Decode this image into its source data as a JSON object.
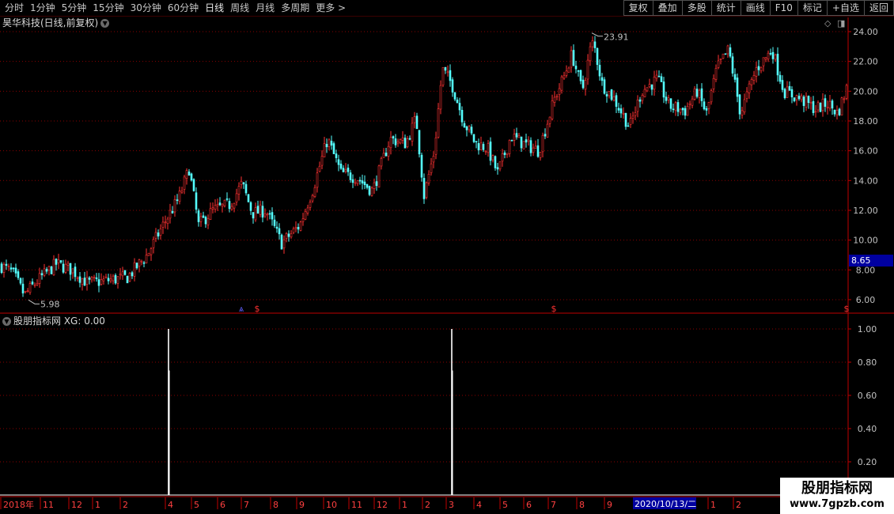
{
  "toolbar": {
    "periods": [
      "分时",
      "1分钟",
      "5分钟",
      "15分钟",
      "30分钟",
      "60分钟",
      "日线",
      "周线",
      "月线",
      "多周期",
      "更多 >"
    ],
    "active": "日线",
    "buttons": [
      "复权",
      "叠加",
      "多股",
      "统计",
      "画线",
      "F10",
      "标记",
      "+自选",
      "返回"
    ]
  },
  "stock": {
    "title": "昊华科技(日线,前复权)"
  },
  "main_chart": {
    "y_ticks": [
      "24.00",
      "22.00",
      "20.00",
      "18.00",
      "16.00",
      "14.00",
      "12.00",
      "10.00",
      "8.00",
      "6.00"
    ],
    "current_price": "8.65",
    "high_label": "23.91",
    "low_label": "5.98"
  },
  "indicator": {
    "title": "股朋指标网 XG: 0.00",
    "y_ticks": [
      "1.00",
      "0.80",
      "0.60",
      "0.40",
      "0.20"
    ]
  },
  "x_axis": {
    "labels": [
      "2018年",
      "11",
      "12",
      "1",
      "2",
      "4",
      "5",
      "6",
      "7",
      "8",
      "9",
      "10",
      "11",
      "12",
      "1",
      "2",
      "3",
      "4",
      "5",
      "6",
      "7",
      "8",
      "9",
      "1",
      "2"
    ],
    "highlight": "2020/10/13/二"
  },
  "watermark": {
    "line1": "股朋指标网",
    "line2": "www.7gpzb.com"
  },
  "colors": {
    "up": "#ff3232",
    "down": "#54ffff",
    "grid": "#8b0000",
    "axis": "#c00000",
    "highlight_bg": "#0000a0"
  },
  "chart_data": {
    "type": "candlestick",
    "ylim": [
      5.5,
      24.5
    ],
    "close_approx": [
      {
        "x": "2018年",
        "y": 8.2
      },
      {
        "x": "11",
        "y": 7.2
      },
      {
        "x": "12",
        "y": 8.4
      },
      {
        "x": "1",
        "y": 7.0
      },
      {
        "x": "2",
        "y": 7.8
      },
      {
        "x": "4",
        "y": 12.5
      },
      {
        "x": "5",
        "y": 11.5
      },
      {
        "x": "6",
        "y": 12.8
      },
      {
        "x": "7",
        "y": 12.0
      },
      {
        "x": "8",
        "y": 9.8
      },
      {
        "x": "9",
        "y": 12.5
      },
      {
        "x": "10",
        "y": 15.5
      },
      {
        "x": "11",
        "y": 14.2
      },
      {
        "x": "12",
        "y": 17.0
      },
      {
        "x": "1",
        "y": 14.5
      },
      {
        "x": "2",
        "y": 21.5
      },
      {
        "x": "3",
        "y": 18.5
      },
      {
        "x": "4",
        "y": 16.8
      },
      {
        "x": "5",
        "y": 17.0
      },
      {
        "x": "6",
        "y": 16.5
      },
      {
        "x": "7",
        "y": 21.0
      },
      {
        "x": "8",
        "y": 21.5
      },
      {
        "x": "9",
        "y": 19.5
      },
      {
        "x": "1",
        "y": 19.5
      },
      {
        "x": "2",
        "y": 19.0
      }
    ],
    "max": 23.91,
    "min": 5.98,
    "xg_signal_positions": [
      "4",
      "3"
    ],
    "xg_value": 0.0
  }
}
